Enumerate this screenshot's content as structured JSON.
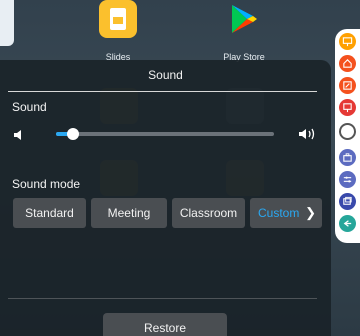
{
  "launcher": {
    "apps": [
      {
        "label": "Slides",
        "icon": "slides-icon"
      },
      {
        "label": "Play Store",
        "icon": "play-store-icon"
      }
    ]
  },
  "panel": {
    "title": "Sound",
    "sound_label": "Sound",
    "volume_level": 0.08,
    "sound_mode_label": "Sound mode",
    "modes": [
      "Standard",
      "Meeting",
      "Classroom",
      "Custom"
    ],
    "selected_mode": "Custom",
    "restore_label": "Restore"
  },
  "colors": {
    "accent": "#2aa8f2",
    "panel_bg": "#1a2228",
    "button_bg": "#4a4e52",
    "toolbar_orange": "#f57c00",
    "toolbar_purple": "#5c6bc0",
    "toolbar_green": "#26a69a"
  },
  "toolbar": {
    "buttons": [
      "whiteboard-icon",
      "home-icon",
      "edit-icon",
      "present-icon",
      "circle-icon",
      "briefcase-icon",
      "settings-sliders-icon",
      "windows-icon",
      "back-icon"
    ]
  }
}
